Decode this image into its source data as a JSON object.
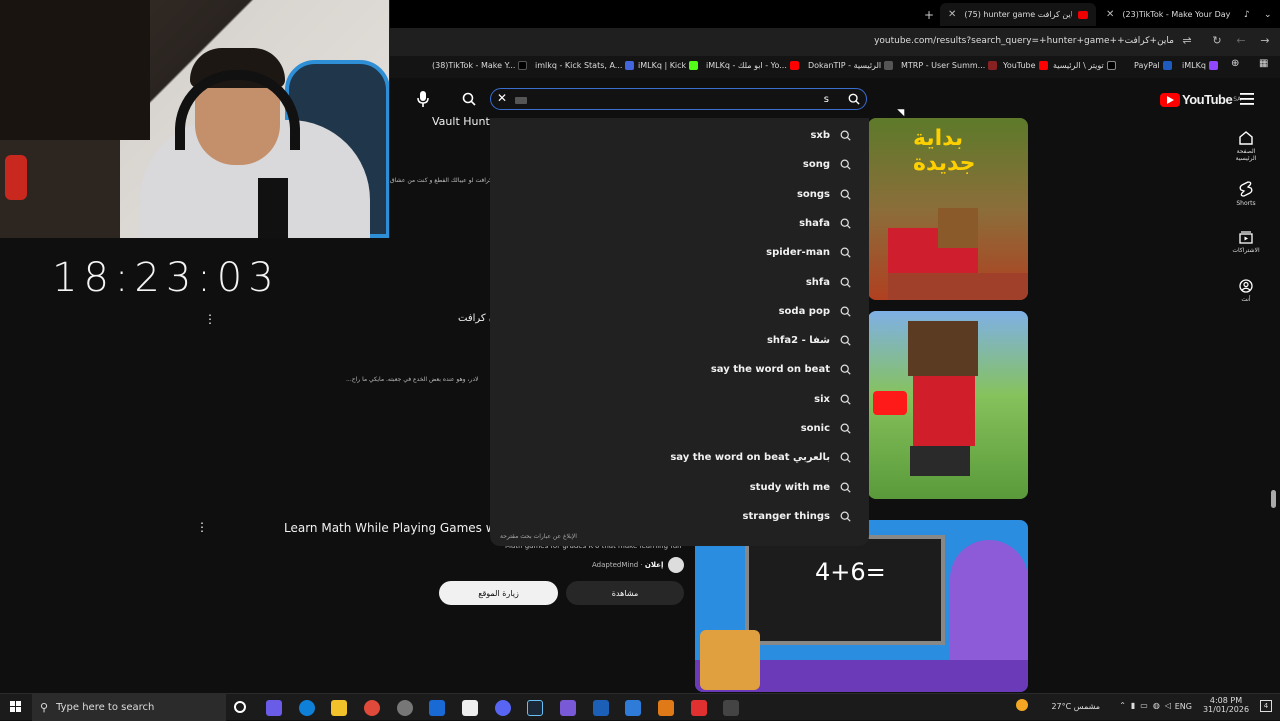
{
  "clock": "18:23:03",
  "tabs": [
    {
      "label": "(75) hunter game ماين كرافت - Y",
      "active": true
    },
    {
      "label": "(23)TikTok - Make Your Day",
      "active": false
    }
  ],
  "url": "youtube.com/results?search_query=+hunter+game++ماين+كرافت",
  "bookmarks": [
    "(38)TikTok - Make Y...",
    "imlkq - Kick Stats, A...",
    "iMLKq | Kick",
    "iMLKq - ابو ملك - Yo...",
    "DokanTIP - الرئيسية",
    "MTRP - User Summ...",
    "YouTube",
    "تويتر \\ الرئيسية",
    "PayPal",
    "iMLKq"
  ],
  "search": {
    "value": "s"
  },
  "logo": {
    "word": "YouTube",
    "region": "SA"
  },
  "suggestions": [
    "sxb",
    "song",
    "songs",
    "shafa",
    "spider-man",
    "shfa",
    "soda pop",
    "shfa2 - شفا",
    "say the word on beat",
    "six",
    "sonic",
    "say the word on beat بالعربي",
    "study with me",
    "stranger things"
  ],
  "suggest_report": "الإبلاغ عن عبارات بحث مقترحة",
  "feed": {
    "vault_title": "Vault Hunt",
    "desc1": "كرافت لو عيبالك الفطع و كنت من عشاق",
    "title2": "ن كرافت",
    "desc2": "...لادر، وهو عنده بعض الخدع في جعبته. مايكي ما راح",
    "ad_title": "Learn Math While Playing Games with",
    "ad_desc": "Math games for grades K-6 that make learning fun",
    "ad_sponsor": "إعلان",
    "ad_brand": "AdaptedMind",
    "ad_visit": "زيارة الموقع",
    "ad_watch": "مشاهدة",
    "thumb1_text": "بداية جديدة",
    "thumb3_text": "4+6="
  },
  "sidebar": [
    {
      "label": "الصفحة الرئيسية",
      "icon": "home-icon"
    },
    {
      "label": "Shorts",
      "icon": "shorts-icon"
    },
    {
      "label": "الاشتراكات",
      "icon": "subscriptions-icon"
    },
    {
      "label": "أنت",
      "icon": "you-icon"
    }
  ],
  "taskbar": {
    "search_placeholder": "Type here to search",
    "weather": "27°C مشمس",
    "lang": "ENG",
    "time": "4:08 PM",
    "date": "31/01/2026",
    "notifications": "4"
  },
  "colors": {
    "accent": "#3ea6ff",
    "brand": "#ff0000",
    "background": "#0f0f0f",
    "dropdown": "#212121"
  }
}
